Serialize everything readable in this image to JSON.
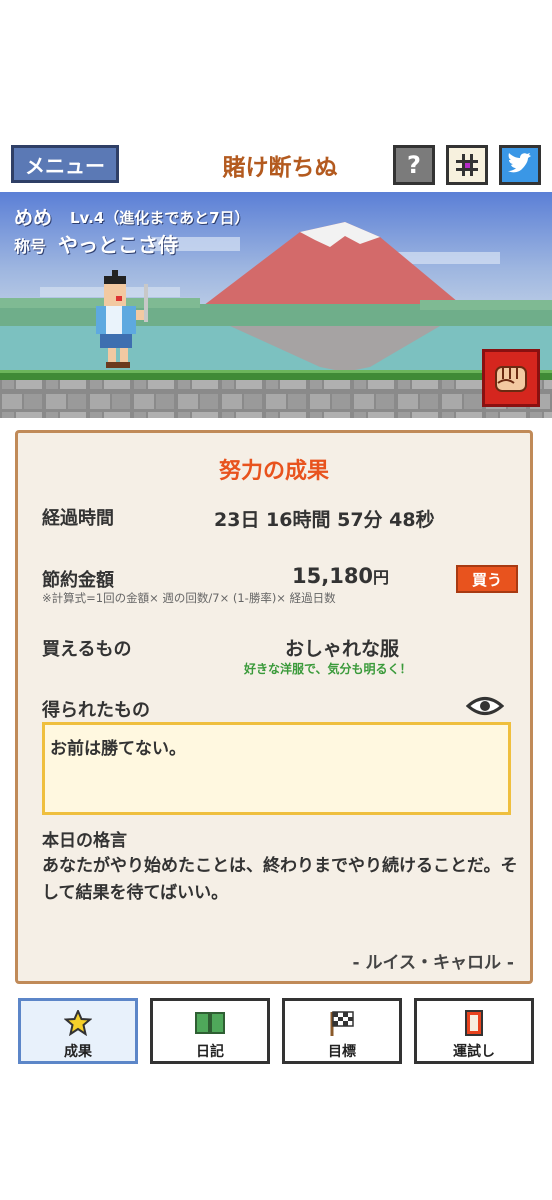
{
  "header": {
    "menu_label": "メニュー",
    "app_title": "賭け断ちぬ",
    "help_label": "?",
    "icons": [
      "grid-icon",
      "twitter-bird-icon"
    ]
  },
  "status": {
    "name": "めめ",
    "level": "Lv.4（進化まであと7日）",
    "title_label": "称号",
    "title_value": "やっとこさ侍"
  },
  "panel": {
    "title": "努力の成果",
    "elapsed_label": "経過時間",
    "elapsed_value": "23日 16時間 57分 48秒",
    "saved_label": "節約金額",
    "saved_amount": "15,180",
    "saved_unit": "円",
    "formula": "※計算式=1回の金額× 週の回数/7× (1-勝率)× 経過日数",
    "buy_label": "買う",
    "buyable_label": "買えるもの",
    "buyable_value": "おしゃれな服",
    "buyable_sub": "好きな洋服で、気分も明るく！",
    "gained_label": "得られたもの",
    "gained_text": "お前は勝てない。",
    "quote_label": "本日の格言",
    "quote_text": "あなたがやり始めたことは、終わりまでやり続けることだ。そして結果を待てばいい。",
    "quote_author": "- ルイス・キャロル -"
  },
  "nav": [
    {
      "label": "成果",
      "icon": "star-icon",
      "active": true
    },
    {
      "label": "日記",
      "icon": "book-icon",
      "active": false
    },
    {
      "label": "目標",
      "icon": "checkered-flag-icon",
      "active": false
    },
    {
      "label": "運試し",
      "icon": "card-icon",
      "active": false
    }
  ],
  "colors": {
    "accent_orange": "#e8531e",
    "title_brown": "#b35a1f",
    "menu_blue": "#5b79b5",
    "panel_border": "#c08a58",
    "box_border": "#efbf3e"
  }
}
